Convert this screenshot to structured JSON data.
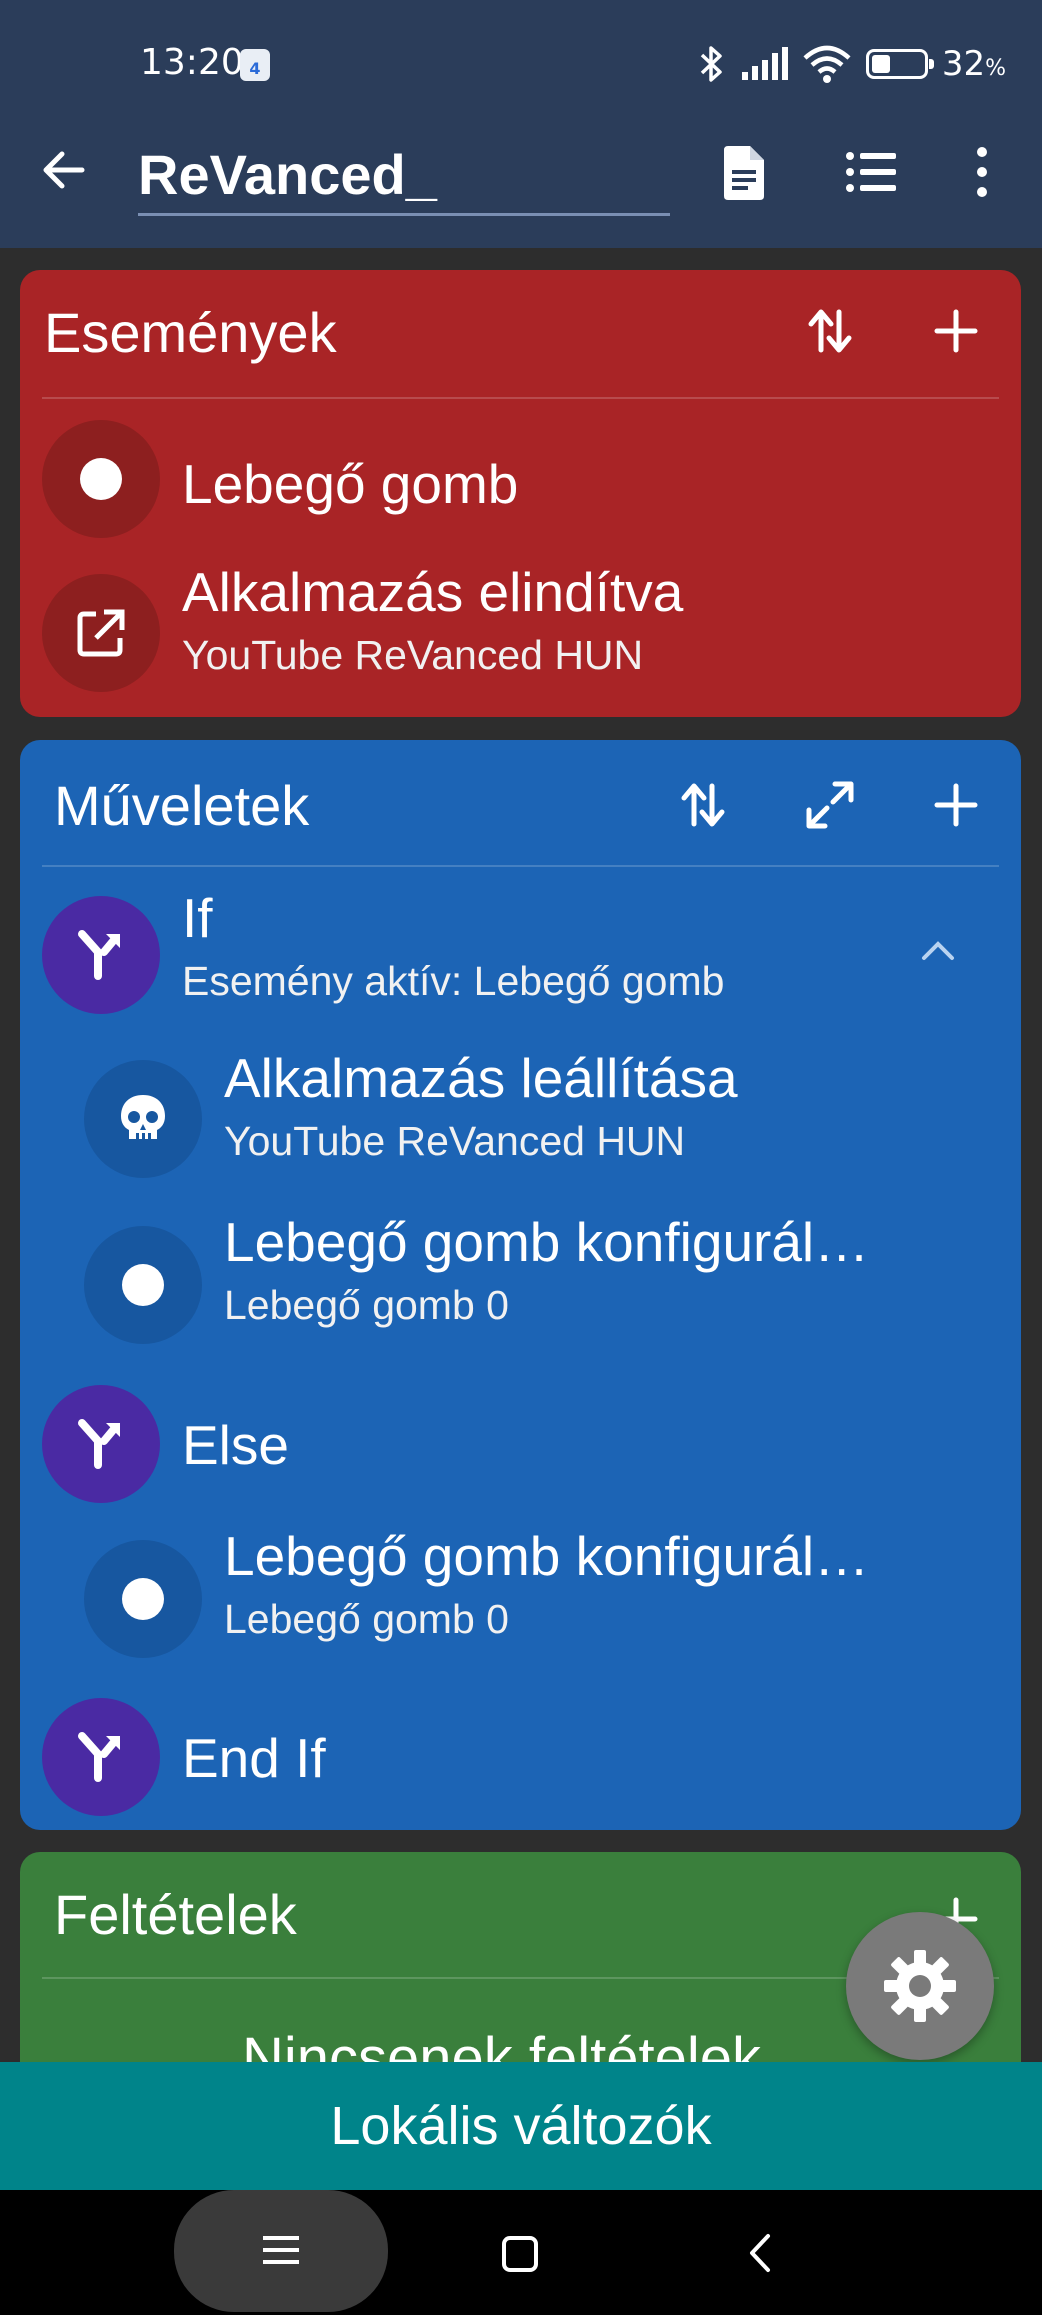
{
  "status_bar": {
    "time": "13:20",
    "notification_badge": "4",
    "battery_percent": "32",
    "battery_unit": "%"
  },
  "app_bar": {
    "title": "ReVanced_",
    "icons": [
      "back-arrow-icon",
      "document-icon",
      "list-icon",
      "more-vert-icon"
    ]
  },
  "events": {
    "header": "Események",
    "items": [
      {
        "title": "Lebegő gomb",
        "subtitle": "",
        "icon": "dot-icon"
      },
      {
        "title": "Alkalmazás elindítva",
        "subtitle": "YouTube ReVanced HUN",
        "icon": "open-external-icon"
      }
    ]
  },
  "actions": {
    "header": "Műveletek",
    "items": [
      {
        "title": "If",
        "subtitle": "Esemény aktív: Lebegő gomb",
        "icon": "branch-icon"
      },
      {
        "title": "Alkalmazás leállítása",
        "subtitle": "YouTube ReVanced HUN",
        "icon": "skull-icon"
      },
      {
        "title": "Lebegő gomb konfigurál…",
        "subtitle": "Lebegő gomb 0",
        "icon": "dot-icon"
      },
      {
        "title": "Else",
        "subtitle": "",
        "icon": "branch-icon"
      },
      {
        "title": "Lebegő gomb konfigurál…",
        "subtitle": "Lebegő gomb 0",
        "icon": "dot-icon"
      },
      {
        "title": "End If",
        "subtitle": "",
        "icon": "branch-icon"
      }
    ]
  },
  "conditions": {
    "header": "Feltételek",
    "empty_text": "Nincsenek feltételek"
  },
  "bottom_tab": {
    "label": "Lokális változók"
  },
  "colors": {
    "events": "#a92426",
    "actions": "#1c64b5",
    "conditions": "#3a7f3c",
    "bottom_tab": "#00848a",
    "branch_circle": "#4a2aa3"
  }
}
